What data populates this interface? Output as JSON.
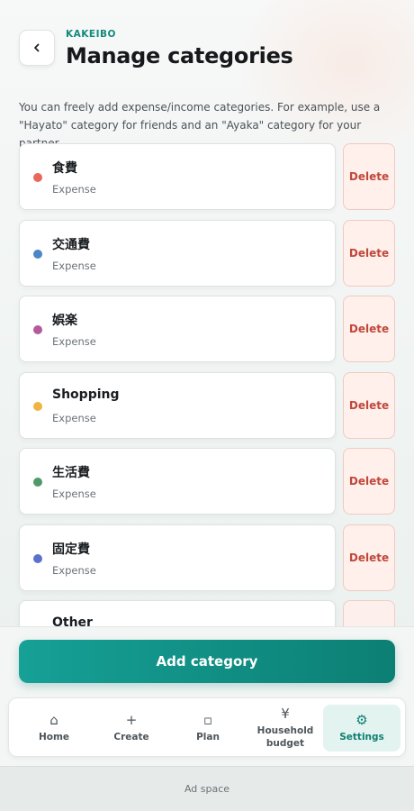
{
  "header": {
    "brand": "KAKEIBO",
    "title": "Manage categories",
    "back_icon": "chevron-left-icon"
  },
  "description": "You can freely add expense/income categories. For example, use a \"Hayato\" category for friends and an \"Ayaka\" category for your partner.",
  "categories": [
    {
      "name": "食費",
      "type": "Expense",
      "color": "#e8685a",
      "delete_label": "Delete"
    },
    {
      "name": "交通費",
      "type": "Expense",
      "color": "#4a86c8",
      "delete_label": "Delete"
    },
    {
      "name": "娯楽",
      "type": "Expense",
      "color": "#b45a9a",
      "delete_label": "Delete"
    },
    {
      "name": "Shopping",
      "type": "Expense",
      "color": "#eeb540",
      "delete_label": "Delete"
    },
    {
      "name": "生活費",
      "type": "Expense",
      "color": "#4f9a68",
      "delete_label": "Delete"
    },
    {
      "name": "固定費",
      "type": "Expense",
      "color": "#5b72cc",
      "delete_label": "Delete"
    },
    {
      "name": "Other",
      "type": "",
      "color": "",
      "delete_label": ""
    }
  ],
  "add_button": "Add category",
  "tabs": [
    {
      "label": "Home",
      "icon": "home-icon",
      "glyph": "⌂"
    },
    {
      "label": "Create",
      "icon": "plus-icon",
      "glyph": "+"
    },
    {
      "label": "Plan",
      "icon": "square-icon",
      "glyph": "▫"
    },
    {
      "label": "Household budget",
      "icon": "yen-icon",
      "glyph": "¥"
    },
    {
      "label": "Settings",
      "icon": "gear-icon",
      "glyph": "⚙"
    }
  ],
  "active_tab": "Settings",
  "ad_label": "Ad space",
  "colors": {
    "accent": "#138a7c",
    "delete_text": "#c0483b",
    "delete_bg": "#fff0ec"
  }
}
